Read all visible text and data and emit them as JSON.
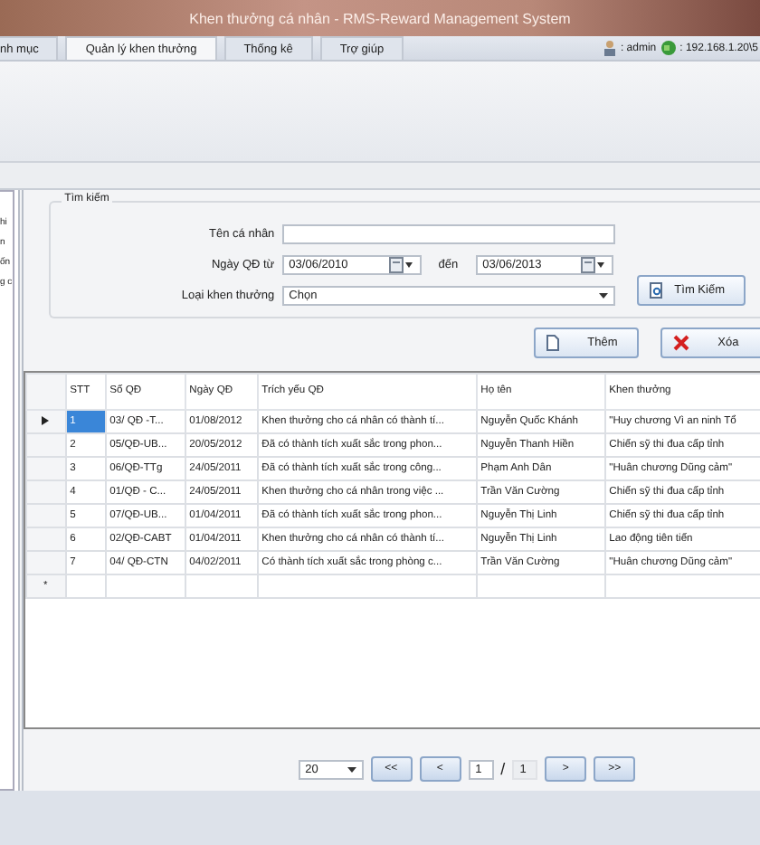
{
  "window": {
    "title": "Khen thưởng cá nhân - RMS-Reward Management System"
  },
  "tabs": [
    {
      "label": "nh mục",
      "selected": false
    },
    {
      "label": "Quản lý khen thưởng",
      "selected": true
    },
    {
      "label": "Thống kê",
      "selected": false
    },
    {
      "label": "Trợ giúp",
      "selected": false
    }
  ],
  "user": {
    "name": ": admin",
    "server": ": 192.168.1.20\\5"
  },
  "sidebar": {
    "items": [
      "hi",
      "n",
      "ốn",
      "g c"
    ]
  },
  "search": {
    "title": "Tìm kiếm",
    "name_label": "Tên cá nhân",
    "date_label": "Ngày QĐ từ",
    "date_from": "03/06/2010",
    "date_to_label": "đến",
    "date_to": "03/06/2013",
    "type_label": "Loại khen thưởng",
    "type_value": "Chọn",
    "search_button": "Tìm Kiếm"
  },
  "actions": {
    "add": "Thêm",
    "delete": "Xóa"
  },
  "table": {
    "columns": [
      "STT",
      "Số QĐ",
      "Ngày QĐ",
      "Trích yếu QĐ",
      "Họ tên",
      "Khen thưởng"
    ],
    "rows": [
      {
        "selected": true,
        "cells": [
          "1",
          "03/ QĐ -T...",
          "01/08/2012",
          "Khen thưởng cho cá nhân có thành tí...",
          "Nguyễn Quốc Khánh",
          "\"Huy chương Vì an ninh Tổ"
        ]
      },
      {
        "selected": false,
        "cells": [
          "2",
          "05/QĐ-UB...",
          "20/05/2012",
          "Đã có thành tích xuất sắc trong phon...",
          "Nguyễn Thanh  Hiền",
          "Chiến sỹ thi đua cấp tỉnh"
        ]
      },
      {
        "selected": false,
        "cells": [
          "3",
          "06/QĐ-TTg",
          "24/05/2011",
          "Đã có thành tích xuất sắc trong công...",
          "Phạm Anh  Dân",
          "\"Huân chương Dũng cảm\""
        ]
      },
      {
        "selected": false,
        "cells": [
          "4",
          "01/QĐ - C...",
          "24/05/2011",
          "Khen thưởng cho cá nhân trong việc ...",
          "Trần Văn Cường",
          "Chiến sỹ thi đua cấp tỉnh"
        ]
      },
      {
        "selected": false,
        "cells": [
          "5",
          "07/QĐ-UB...",
          "01/04/2011",
          "Đã có thành tích xuất sắc trong phon...",
          "Nguyễn Thị Linh",
          "Chiến sỹ thi đua cấp tỉnh"
        ]
      },
      {
        "selected": false,
        "cells": [
          "6",
          "02/QĐ-CABT",
          "01/04/2011",
          "Khen thưởng cho cá nhân có thành tí...",
          "Nguyễn Thị Linh",
          "Lao động tiên tiến"
        ]
      },
      {
        "selected": false,
        "cells": [
          "7",
          "04/ QĐ-CTN",
          "04/02/2011",
          "Có thành tích xuất sắc trong phòng c...",
          "Trần Văn Cường",
          "\"Huân chương Dũng cảm\""
        ]
      }
    ],
    "new_row_marker": "*"
  },
  "pager": {
    "page_size": "20",
    "first": "<<",
    "prev": "<",
    "page": "1",
    "separator": "/",
    "total": "1",
    "next": ">",
    "last": ">>"
  }
}
